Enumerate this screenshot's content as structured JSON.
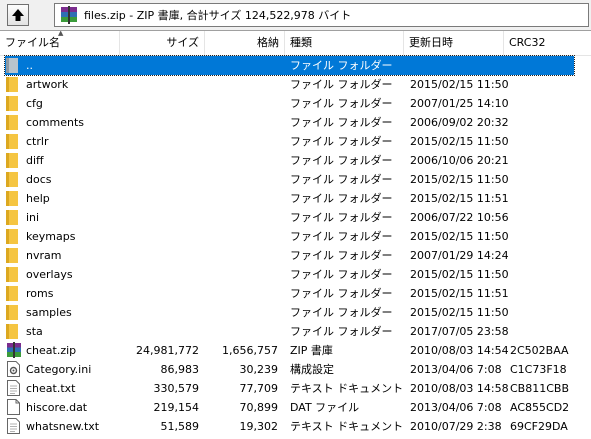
{
  "pathbar": {
    "up_icon": "up-arrow-icon",
    "archive_icon": "winrar-archive-icon",
    "path_text": "files.zip - ZIP 書庫, 合計サイズ 124,522,978 バイト"
  },
  "columns": {
    "name": "ファイル名",
    "size": "サイズ",
    "packed": "格納",
    "type": "種類",
    "modified": "更新日時",
    "crc": "CRC32"
  },
  "files": [
    {
      "name": "..",
      "size": "",
      "packed": "",
      "type": "ファイル フォルダー",
      "modified": "",
      "crc": "",
      "icon": "parent-folder-icon",
      "selected": true
    },
    {
      "name": "artwork",
      "size": "",
      "packed": "",
      "type": "ファイル フォルダー",
      "modified": "2015/02/15 11:50",
      "crc": "",
      "icon": "folder-icon"
    },
    {
      "name": "cfg",
      "size": "",
      "packed": "",
      "type": "ファイル フォルダー",
      "modified": "2007/01/25 14:10",
      "crc": "",
      "icon": "folder-icon"
    },
    {
      "name": "comments",
      "size": "",
      "packed": "",
      "type": "ファイル フォルダー",
      "modified": "2006/09/02 20:32",
      "crc": "",
      "icon": "folder-icon"
    },
    {
      "name": "ctrlr",
      "size": "",
      "packed": "",
      "type": "ファイル フォルダー",
      "modified": "2015/02/15 11:50",
      "crc": "",
      "icon": "folder-icon"
    },
    {
      "name": "diff",
      "size": "",
      "packed": "",
      "type": "ファイル フォルダー",
      "modified": "2006/10/06 20:21",
      "crc": "",
      "icon": "folder-icon"
    },
    {
      "name": "docs",
      "size": "",
      "packed": "",
      "type": "ファイル フォルダー",
      "modified": "2015/02/15 11:50",
      "crc": "",
      "icon": "folder-icon"
    },
    {
      "name": "help",
      "size": "",
      "packed": "",
      "type": "ファイル フォルダー",
      "modified": "2015/02/15 11:51",
      "crc": "",
      "icon": "folder-icon"
    },
    {
      "name": "ini",
      "size": "",
      "packed": "",
      "type": "ファイル フォルダー",
      "modified": "2006/07/22 10:56",
      "crc": "",
      "icon": "folder-icon"
    },
    {
      "name": "keymaps",
      "size": "",
      "packed": "",
      "type": "ファイル フォルダー",
      "modified": "2015/02/15 11:50",
      "crc": "",
      "icon": "folder-icon"
    },
    {
      "name": "nvram",
      "size": "",
      "packed": "",
      "type": "ファイル フォルダー",
      "modified": "2007/01/29 14:24",
      "crc": "",
      "icon": "folder-icon"
    },
    {
      "name": "overlays",
      "size": "",
      "packed": "",
      "type": "ファイル フォルダー",
      "modified": "2015/02/15 11:50",
      "crc": "",
      "icon": "folder-icon"
    },
    {
      "name": "roms",
      "size": "",
      "packed": "",
      "type": "ファイル フォルダー",
      "modified": "2015/02/15 11:51",
      "crc": "",
      "icon": "folder-icon"
    },
    {
      "name": "samples",
      "size": "",
      "packed": "",
      "type": "ファイル フォルダー",
      "modified": "2015/02/15 11:50",
      "crc": "",
      "icon": "folder-icon"
    },
    {
      "name": "sta",
      "size": "",
      "packed": "",
      "type": "ファイル フォルダー",
      "modified": "2017/07/05 23:58",
      "crc": "",
      "icon": "folder-icon"
    },
    {
      "name": "cheat.zip",
      "size": "24,981,772",
      "packed": "1,656,757",
      "type": "ZIP 書庫",
      "modified": "2010/08/03 14:54",
      "crc": "2C502BAA",
      "icon": "zip-archive-icon"
    },
    {
      "name": "Category.ini",
      "size": "86,983",
      "packed": "30,239",
      "type": "構成設定",
      "modified": "2013/04/06 7:08",
      "crc": "C1C73F18",
      "icon": "settings-file-icon"
    },
    {
      "name": "cheat.txt",
      "size": "330,579",
      "packed": "77,709",
      "type": "テキスト ドキュメント",
      "modified": "2010/08/03 14:58",
      "crc": "CB811CBB",
      "icon": "text-file-icon"
    },
    {
      "name": "hiscore.dat",
      "size": "219,154",
      "packed": "70,899",
      "type": "DAT ファイル",
      "modified": "2013/04/06 7:08",
      "crc": "AC855CD2",
      "icon": "file-icon"
    },
    {
      "name": "whatsnew.txt",
      "size": "51,589",
      "packed": "19,302",
      "type": "テキスト ドキュメント",
      "modified": "2010/07/29 2:38",
      "crc": "69CF29DA",
      "icon": "text-file-icon"
    }
  ],
  "colors": {
    "selection": "#0078d7",
    "folder": "#f5c542",
    "toolbar_bg": "#f0f0f0"
  }
}
